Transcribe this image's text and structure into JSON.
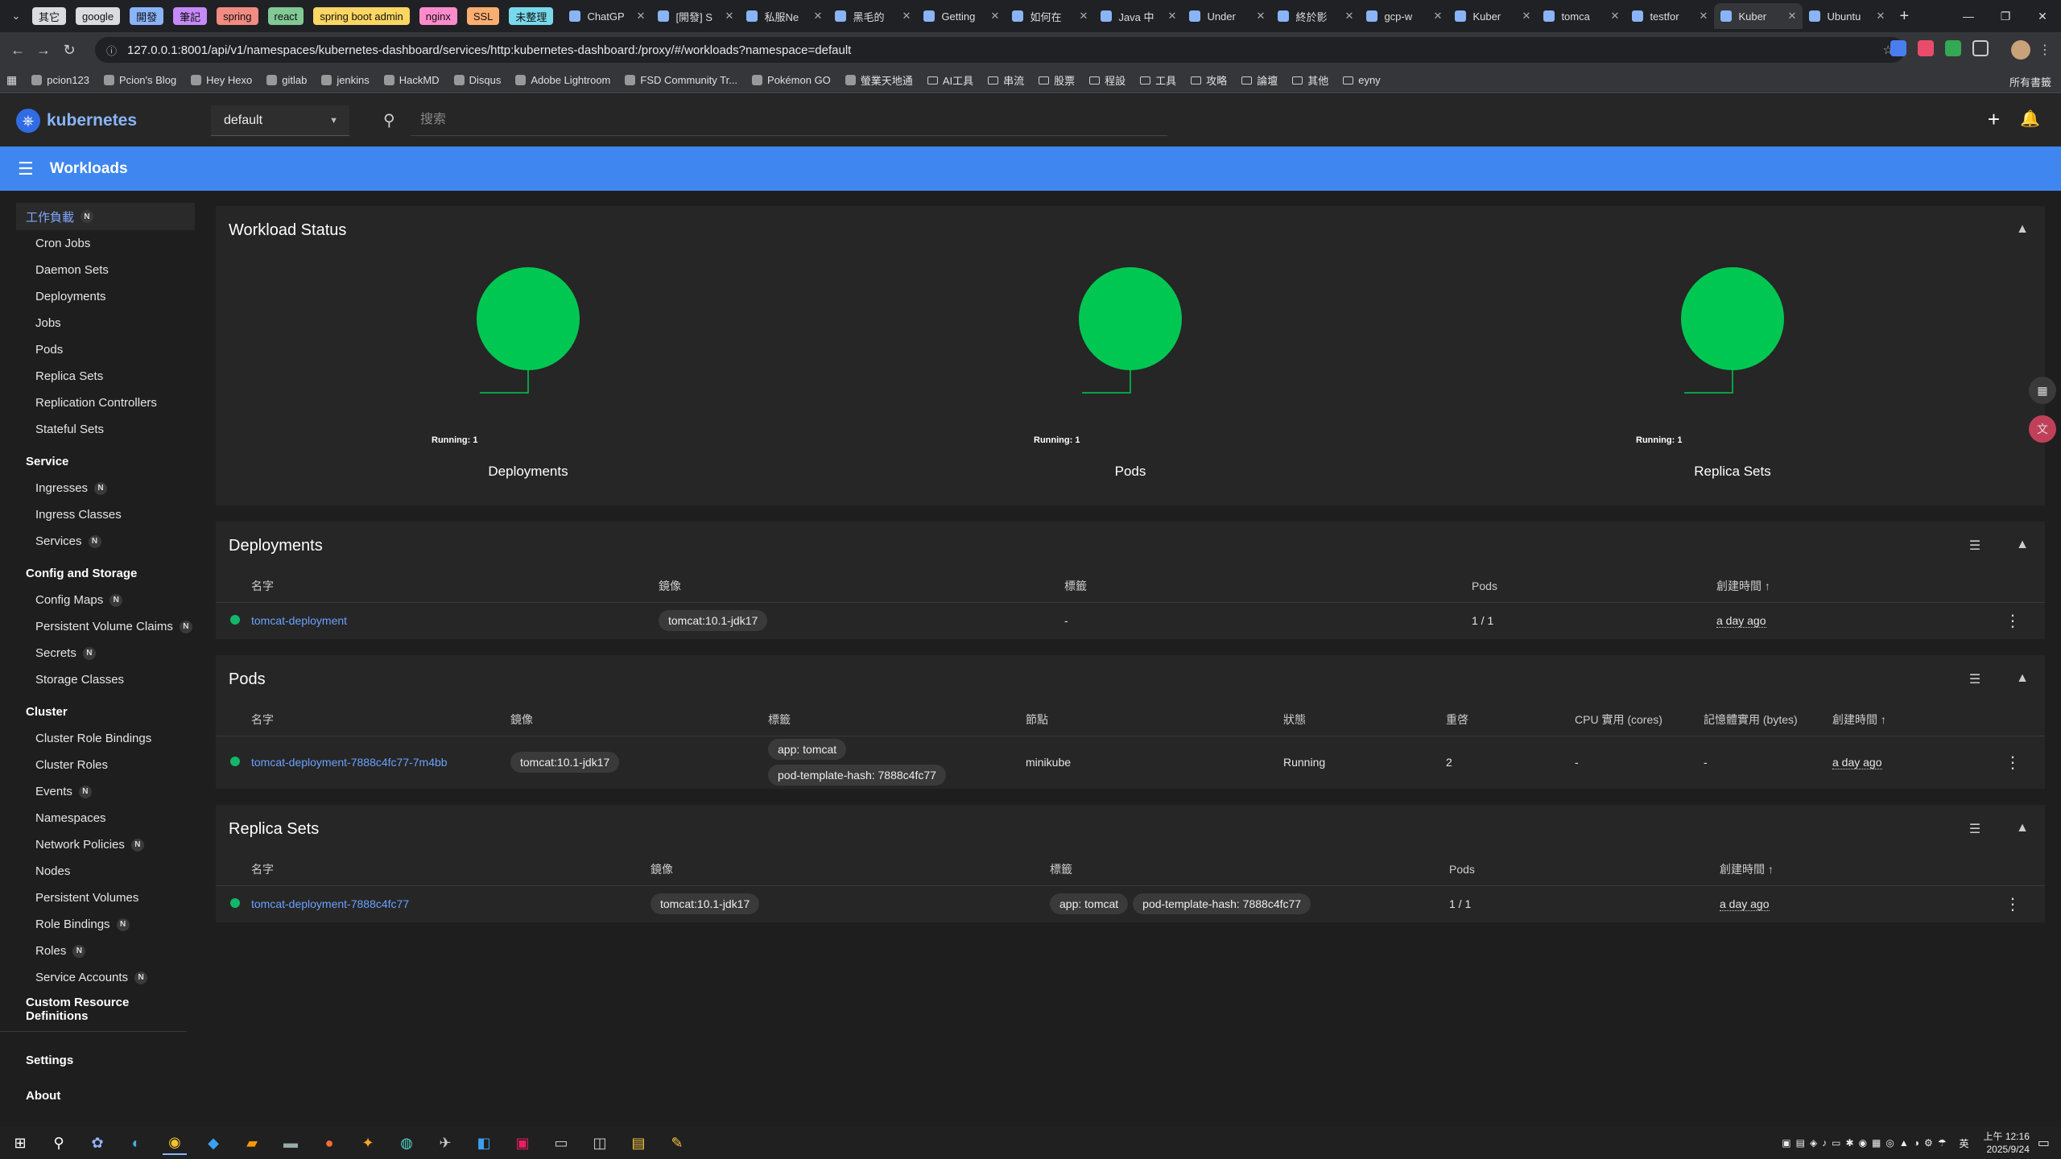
{
  "browser": {
    "group_tabs": [
      {
        "label": "其它",
        "color": "#dadce0"
      },
      {
        "label": "google",
        "color": "#dadce0"
      },
      {
        "label": "開發",
        "color": "#8ab4f8"
      },
      {
        "label": "筆記",
        "color": "#c58af9"
      },
      {
        "label": "spring",
        "color": "#f28b82"
      },
      {
        "label": "react",
        "color": "#81c995"
      },
      {
        "label": "spring boot admin",
        "color": "#fdd663"
      },
      {
        "label": "nginx",
        "color": "#ff8bcb"
      },
      {
        "label": "SSL",
        "color": "#fcad70"
      },
      {
        "label": "未整理",
        "color": "#78d9ec"
      }
    ],
    "tabs": [
      "ChatGP",
      "[開發] S",
      "私服Ne",
      "黑毛的",
      "Getting",
      "如何在",
      "Java 中",
      "Under",
      "終於影",
      "gcp-w",
      "Kuber",
      "tomca",
      "testfor",
      "Kuber",
      "Ubuntu"
    ],
    "active_tab_index": 13,
    "url": "127.0.0.1:8001/api/v1/namespaces/kubernetes-dashboard/services/http:kubernetes-dashboard:/proxy/#/workloads?namespace=default",
    "bookmarks": [
      "pcion123",
      "Pcion's Blog",
      "Hey Hexo",
      "gitlab",
      "jenkins",
      "HackMD",
      "Disqus",
      "Adobe Lightroom",
      "FSD Community Tr...",
      "Pokémon GO",
      "螢業天地通"
    ],
    "bookmark_folders": [
      "AI工具",
      "串流",
      "股票",
      "程設",
      "工具",
      "攻略",
      "論壇",
      "其他",
      "eyny"
    ],
    "all_bookmarks": "所有書籤"
  },
  "header": {
    "brand": "kubernetes",
    "namespace": "default",
    "search_placeholder": "搜索",
    "page_title": "Workloads"
  },
  "sidebar": {
    "workloads_group": "工作負載",
    "workloads": [
      "Cron Jobs",
      "Daemon Sets",
      "Deployments",
      "Jobs",
      "Pods",
      "Replica Sets",
      "Replication Controllers",
      "Stateful Sets"
    ],
    "service_group": "Service",
    "service_items": [
      {
        "label": "Ingresses",
        "badge": "N"
      },
      {
        "label": "Ingress Classes",
        "badge": ""
      },
      {
        "label": "Services",
        "badge": "N"
      }
    ],
    "config_group": "Config and Storage",
    "config_items": [
      {
        "label": "Config Maps",
        "badge": "N"
      },
      {
        "label": "Persistent Volume Claims",
        "badge": "N"
      },
      {
        "label": "Secrets",
        "badge": "N"
      },
      {
        "label": "Storage Classes",
        "badge": ""
      }
    ],
    "cluster_group": "Cluster",
    "cluster_items": [
      {
        "label": "Cluster Role Bindings",
        "badge": ""
      },
      {
        "label": "Cluster Roles",
        "badge": ""
      },
      {
        "label": "Events",
        "badge": "N"
      },
      {
        "label": "Namespaces",
        "badge": ""
      },
      {
        "label": "Network Policies",
        "badge": "N"
      },
      {
        "label": "Nodes",
        "badge": ""
      },
      {
        "label": "Persistent Volumes",
        "badge": ""
      },
      {
        "label": "Role Bindings",
        "badge": "N"
      },
      {
        "label": "Roles",
        "badge": "N"
      },
      {
        "label": "Service Accounts",
        "badge": "N"
      }
    ],
    "crd": "Custom Resource Definitions",
    "settings": "Settings",
    "about": "About",
    "badge_N": "N"
  },
  "workload_status": {
    "title": "Workload Status",
    "gauges": [
      {
        "label": "Deployments",
        "running": "Running: 1",
        "color": "#00c752"
      },
      {
        "label": "Pods",
        "running": "Running: 1",
        "color": "#00c752"
      },
      {
        "label": "Replica Sets",
        "running": "Running: 1",
        "color": "#00c752"
      }
    ]
  },
  "deployments": {
    "title": "Deployments",
    "headers": [
      "名字",
      "鏡像",
      "標籤",
      "Pods",
      "創建時間 ↑"
    ],
    "row": {
      "name": "tomcat-deployment",
      "image": "tomcat:10.1-jdk17",
      "labels": "-",
      "pods": "1 / 1",
      "created": "a day ago"
    }
  },
  "pods": {
    "title": "Pods",
    "headers": [
      "名字",
      "鏡像",
      "標籤",
      "節點",
      "狀態",
      "重啓",
      "CPU 實用 (cores)",
      "記憶體實用 (bytes)",
      "創建時間 ↑"
    ],
    "row": {
      "name": "tomcat-deployment-7888c4fc77-7m4bb",
      "image": "tomcat:10.1-jdk17",
      "label1": "app: tomcat",
      "label2": "pod-template-hash: 7888c4fc77",
      "node": "minikube",
      "status": "Running",
      "restarts": "2",
      "cpu": "-",
      "mem": "-",
      "created": "a day ago"
    }
  },
  "replicasets": {
    "title": "Replica Sets",
    "headers": [
      "名字",
      "鏡像",
      "標籤",
      "Pods",
      "創建時間 ↑"
    ],
    "row": {
      "name": "tomcat-deployment-7888c4fc77",
      "image": "tomcat:10.1-jdk17",
      "label1": "app: tomcat",
      "label2": "pod-template-hash: 7888c4fc77",
      "pods": "1 / 1",
      "created": "a day ago"
    }
  },
  "taskbar": {
    "time": "上午 12:16",
    "date": "2025/9/24",
    "ime": "英"
  }
}
